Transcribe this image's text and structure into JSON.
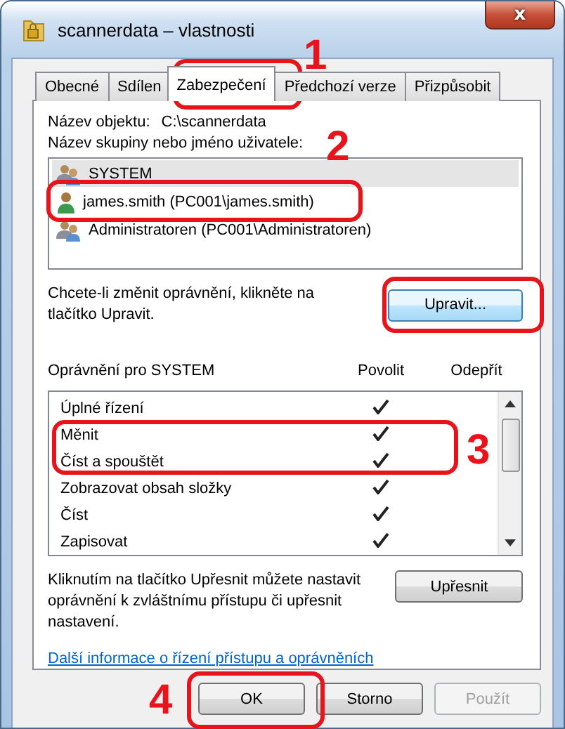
{
  "window": {
    "title": "scannerdata – vlastnosti",
    "close_label": "x"
  },
  "tabs": [
    {
      "label": "Obecné",
      "selected": false
    },
    {
      "label": "Sdílen",
      "selected": false
    },
    {
      "label": "Zabezpečení",
      "selected": true
    },
    {
      "label": "Předchozí verze",
      "selected": false
    },
    {
      "label": "Přizpůsobit",
      "selected": false
    }
  ],
  "object_name": {
    "label": "Název objektu:",
    "value": "C:\\scannerdata"
  },
  "users_label": "Název skupiny nebo jméno uživatele:",
  "users": [
    {
      "name": "SYSTEM",
      "kind": "group",
      "selected": true
    },
    {
      "name": "james.smith (PC001\\james.smith)",
      "kind": "user",
      "selected": false
    },
    {
      "name": "Administratoren (PC001\\Administratoren)",
      "kind": "group",
      "selected": false
    }
  ],
  "edit_hint": "Chcete-li změnit oprávnění, klikněte na tlačítko Upravit.",
  "edit_button": "Upravit...",
  "permissions_label": "Oprávnění pro SYSTEM",
  "permission_columns": [
    "Povolit",
    "Odepřít"
  ],
  "permissions": [
    {
      "name": "Úplné řízení",
      "allow": true,
      "deny": false
    },
    {
      "name": "Měnit",
      "allow": true,
      "deny": false
    },
    {
      "name": "Číst a spouštět",
      "allow": true,
      "deny": false
    },
    {
      "name": "Zobrazovat obsah složky",
      "allow": true,
      "deny": false
    },
    {
      "name": "Číst",
      "allow": true,
      "deny": false
    },
    {
      "name": "Zapisovat",
      "allow": true,
      "deny": false
    }
  ],
  "advanced_hint": "Kliknutím na tlačítko Upřesnit můžete nastavit oprávnění k zvláštnímu přístupu či upřesnit nastavení.",
  "advanced_button": "Upřesnit",
  "help_link": "Další informace o řízení přístupu a oprávněních",
  "buttons": [
    {
      "label": "OK",
      "disabled": false
    },
    {
      "label": "Storno",
      "disabled": false
    },
    {
      "label": "Použít",
      "disabled": true
    }
  ],
  "callouts": [
    {
      "kind": "numbered",
      "label": "1"
    },
    {
      "kind": "numbered",
      "label": "2"
    },
    {
      "kind": "plain"
    },
    {
      "kind": "numbered",
      "label": "3"
    },
    {
      "kind": "numbered",
      "label": "4"
    }
  ]
}
